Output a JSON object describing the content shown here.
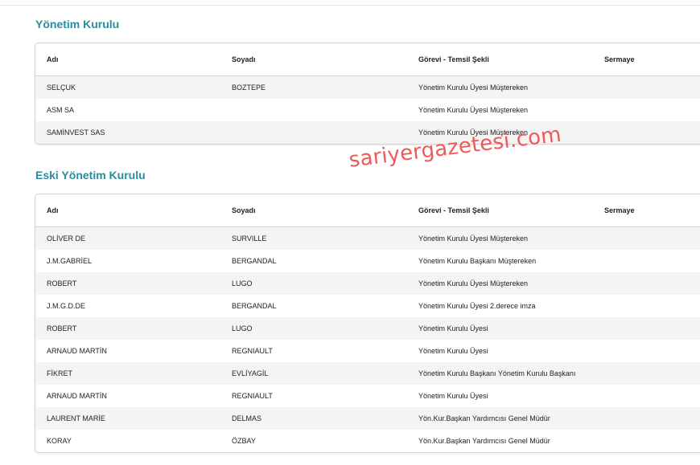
{
  "watermark": "sariyergazetesi.com",
  "sections": [
    {
      "title": "Yönetim Kurulu",
      "headers": [
        "Adı",
        "Soyadı",
        "Görevi - Temsil Şekli",
        "Sermaye"
      ],
      "rows": [
        [
          "SELÇUK",
          "BOZTEPE",
          "Yönetim Kurulu Üyesi Müştereken",
          ""
        ],
        [
          "ASM SA",
          "",
          "Yönetim Kurulu Üyesi Müştereken",
          ""
        ],
        [
          "SAMİNVEST SAS",
          "",
          "Yönetim Kurulu Üyesi Müştereken",
          ""
        ]
      ]
    },
    {
      "title": "Eski Yönetim Kurulu",
      "headers": [
        "Adı",
        "Soyadı",
        "Görevi - Temsil Şekli",
        "Sermaye"
      ],
      "rows": [
        [
          "OLİVER DE",
          "SURVILLE",
          "Yönetim Kurulu Üyesi Müştereken",
          ""
        ],
        [
          "J.M.GABRİEL",
          "BERGANDAL",
          "Yönetim Kurulu Başkanı Müştereken",
          ""
        ],
        [
          "ROBERT",
          "LUGO",
          "Yönetim Kurulu Üyesi Müştereken",
          ""
        ],
        [
          "J.M.G.D.DE",
          "BERGANDAL",
          "Yönetim Kurulu Üyesi 2.derece imza",
          ""
        ],
        [
          "ROBERT",
          "LUGO",
          "Yönetim Kurulu Üyesi",
          ""
        ],
        [
          "ARNAUD MARTİN",
          "REGNIAULT",
          "Yönetim Kurulu Üyesi",
          ""
        ],
        [
          "FİKRET",
          "EVLİYAGİL",
          "Yönetim Kurulu Başkanı Yönetim Kurulu Başkanı",
          ""
        ],
        [
          "ARNAUD MARTİN",
          "REGNIAULT",
          "Yönetim Kurulu Üyesi",
          ""
        ],
        [
          "LAURENT MARİE",
          "DELMAS",
          "Yön.Kur.Başkan Yardımcısı Genel Müdür",
          ""
        ],
        [
          "KORAY",
          "ÖZBAY",
          "Yön.Kur.Başkan Yardımcısı Genel Müdür",
          ""
        ]
      ]
    }
  ]
}
